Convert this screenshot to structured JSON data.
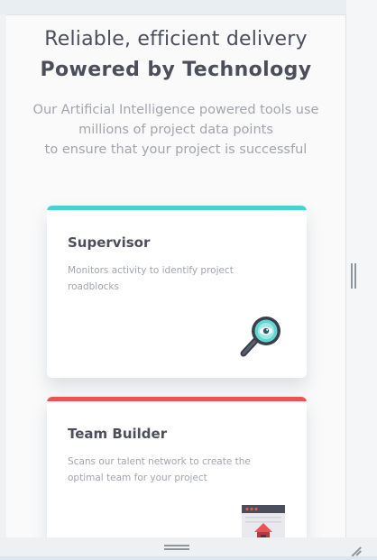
{
  "heading": {
    "light": "Reliable, efficient delivery",
    "bold": "Powered by Technology"
  },
  "intro": {
    "lines": [
      "Our Artificial Intelligence powered tools use",
      "millions of project data points",
      "to ensure that your project is successful"
    ]
  },
  "cards": [
    {
      "title": "Supervisor",
      "description": "Monitors activity to identify project roadblocks",
      "accent_color": "#44d3d2",
      "icon": "magnifying-glass-icon"
    },
    {
      "title": "Team Builder",
      "description": "Scans our talent network to create the optimal team for your project",
      "accent_color": "#ea5454",
      "icon": "team-builder-icon"
    }
  ],
  "colors": {
    "text_dark": "#4c4e5c",
    "text_muted": "#a3a5ae",
    "background": "#fafafa"
  }
}
